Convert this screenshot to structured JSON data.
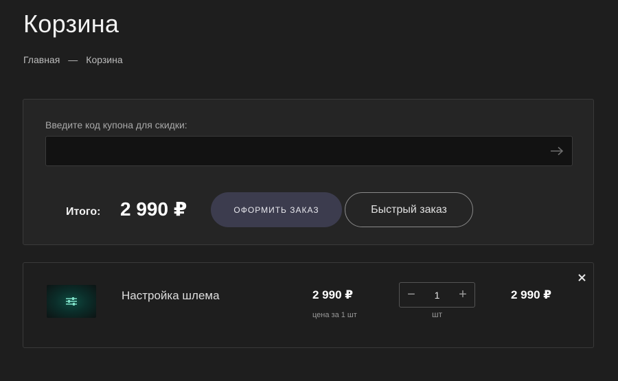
{
  "page": {
    "title": "Корзина"
  },
  "breadcrumb": {
    "home": "Главная",
    "separator": "—",
    "current": "Корзина"
  },
  "coupon": {
    "label": "Введите код купона для скидки:",
    "value": "",
    "placeholder": "",
    "submit_icon": "arrow-right-icon"
  },
  "summary": {
    "total_label": "Итого:",
    "total_value": "2 990 ₽",
    "checkout_label": "ОФОРМИТЬ ЗАКАЗ",
    "quick_order_label": "Быстрый заказ"
  },
  "cart": {
    "items": [
      {
        "name": "Настройка шлема",
        "thumbnail_icon": "sliders-icon",
        "unit_price": "2 990 ₽",
        "unit_price_caption": "цена за 1 шт",
        "quantity": "1",
        "quantity_unit": "шт",
        "minus": "−",
        "plus": "+",
        "line_total": "2 990 ₽",
        "remove_icon": "close-icon"
      }
    ]
  },
  "colors": {
    "background": "#1e1e1e",
    "panel": "#252525",
    "input_bg": "#121212",
    "checkout_button": "#3c3c4e",
    "thumbnail_accent": "#0f4a40"
  }
}
